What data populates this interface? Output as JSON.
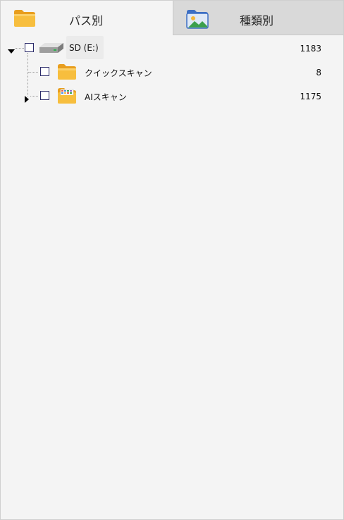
{
  "tabs": [
    {
      "label": "パス別",
      "icon": "folder-icon",
      "active": true
    },
    {
      "label": "種類別",
      "icon": "image-folder-icon",
      "active": false
    }
  ],
  "tree": {
    "root": {
      "label": "SD (E:)",
      "count": "1183",
      "icon": "drive-icon",
      "expanded": true
    },
    "children": [
      {
        "label": "クイックスキャン",
        "count": "8",
        "icon": "folder-icon",
        "expandable": false
      },
      {
        "label": "AIスキャン",
        "count": "1175",
        "icon": "ai-folder-icon",
        "expandable": true
      }
    ]
  },
  "colors": {
    "panel_bg": "#f4f4f4",
    "inactive_tab_bg": "#d9d9d9",
    "folder": "#f5b73b",
    "checkbox_border": "#2b2b6a"
  }
}
